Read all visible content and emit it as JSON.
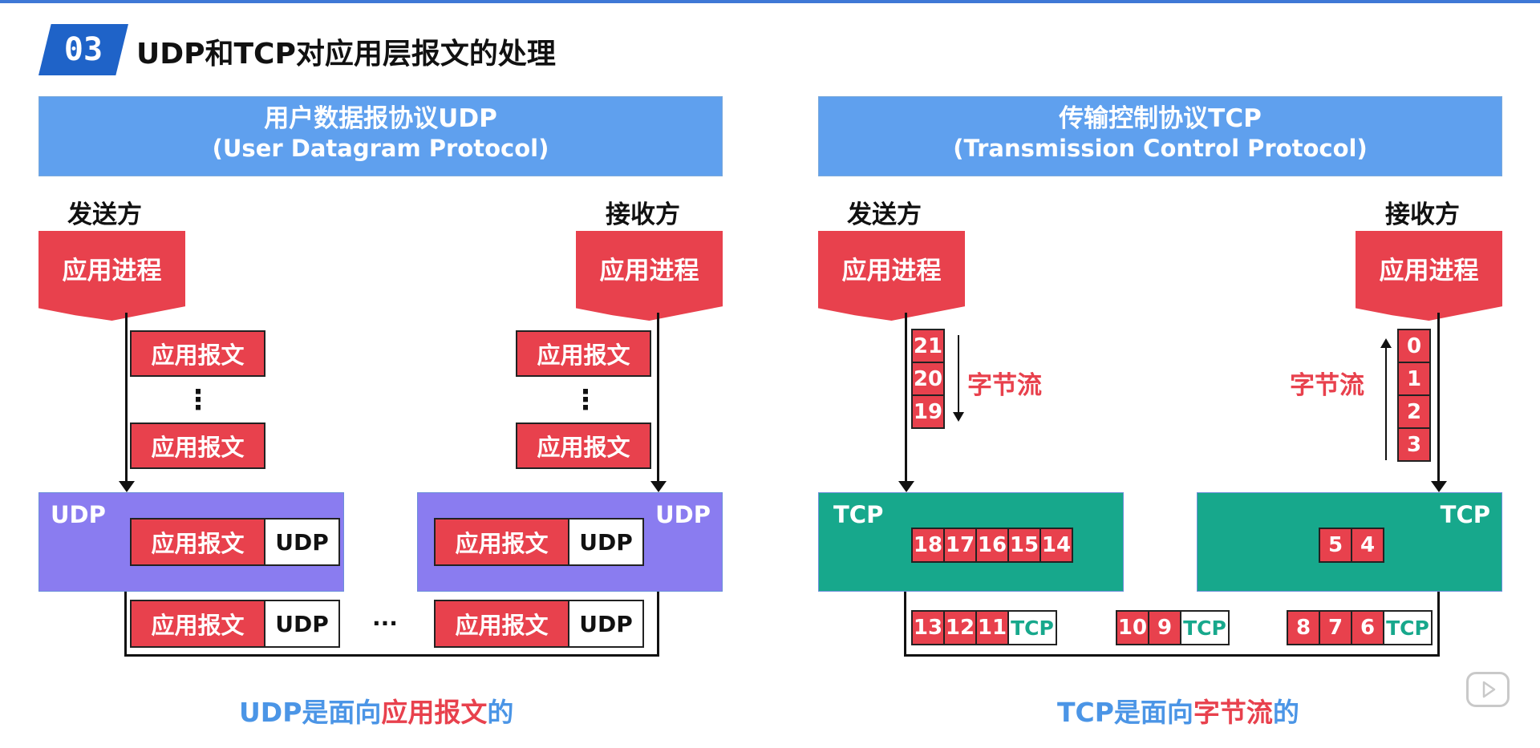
{
  "slide": {
    "number": "03",
    "title": "UDP和TCP对应用层报文的处理"
  },
  "udp": {
    "header_line1": "用户数据报协议UDP",
    "header_line2": "(User Datagram Protocol)",
    "sender_label": "发送方",
    "receiver_label": "接收方",
    "process_label": "应用进程",
    "message_label": "应用报文",
    "udp_header_label": "UDP",
    "box_label": "UDP",
    "ellipsis_vertical": "⋮",
    "ellipsis_horizontal": "···",
    "footer_prefix": "UDP是面向",
    "footer_highlight": "应用报文",
    "footer_suffix": "的"
  },
  "tcp": {
    "header_line1": "传输控制协议TCP",
    "header_line2": "(Transmission Control Protocol)",
    "sender_label": "发送方",
    "receiver_label": "接收方",
    "process_label": "应用进程",
    "box_label": "TCP",
    "tcp_header_label": "TCP",
    "stream_label": "字节流",
    "sender_stack": [
      "21",
      "20",
      "19"
    ],
    "receiver_stack": [
      "0",
      "1",
      "2",
      "3"
    ],
    "sender_buffer": [
      "18",
      "17",
      "16",
      "15",
      "14"
    ],
    "receiver_buffer": [
      "5",
      "4"
    ],
    "segment1": [
      "13",
      "12",
      "11"
    ],
    "segment2": [
      "10",
      "9"
    ],
    "segment3": [
      "8",
      "7",
      "6"
    ],
    "footer_prefix": "TCP是面向",
    "footer_highlight": "字节流",
    "footer_suffix": "的"
  },
  "colors": {
    "header_blue": "#5fa0ee",
    "process_red": "#e8414d",
    "udp_purple": "#8a7cf0",
    "tcp_green": "#17a88c",
    "badge_blue": "#1f63c8"
  }
}
